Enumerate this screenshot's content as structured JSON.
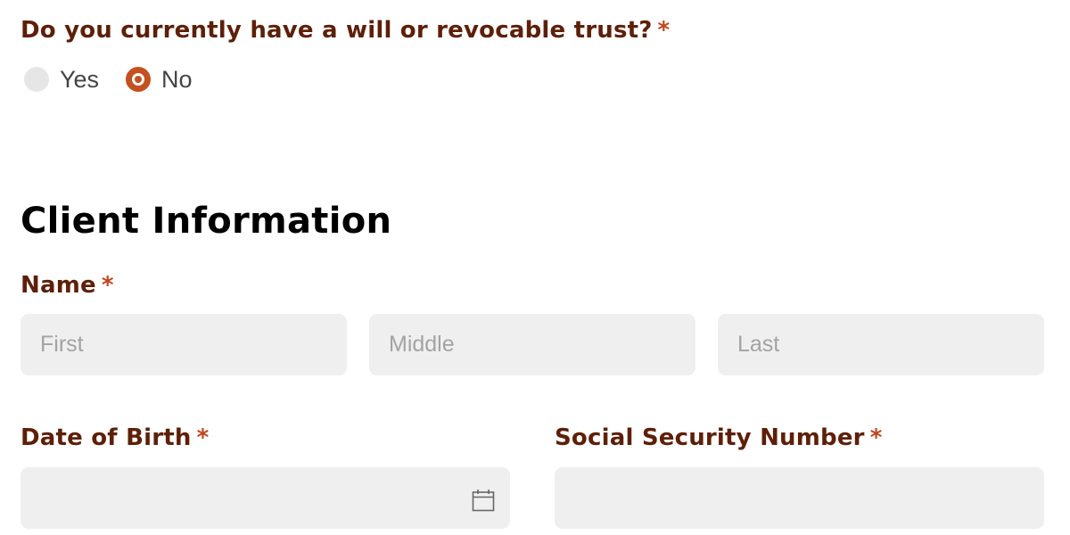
{
  "will_question": {
    "label": "Do you currently have a will or revocable trust?",
    "required_mark": "*",
    "options": [
      {
        "label": "Yes",
        "selected": false
      },
      {
        "label": "No",
        "selected": true
      }
    ]
  },
  "client_info": {
    "title": "Client Information",
    "name": {
      "label": "Name",
      "required_mark": "*",
      "first_placeholder": "First",
      "middle_placeholder": "Middle",
      "last_placeholder": "Last"
    },
    "dob": {
      "label": "Date of Birth",
      "required_mark": "*",
      "icon": "calendar-icon"
    },
    "ssn": {
      "label": "Social Security Number",
      "required_mark": "*"
    }
  },
  "colors": {
    "label": "#5e1f08",
    "required": "#c2451e",
    "radio_selected": "#c4511f",
    "field_bg": "#efefef"
  }
}
